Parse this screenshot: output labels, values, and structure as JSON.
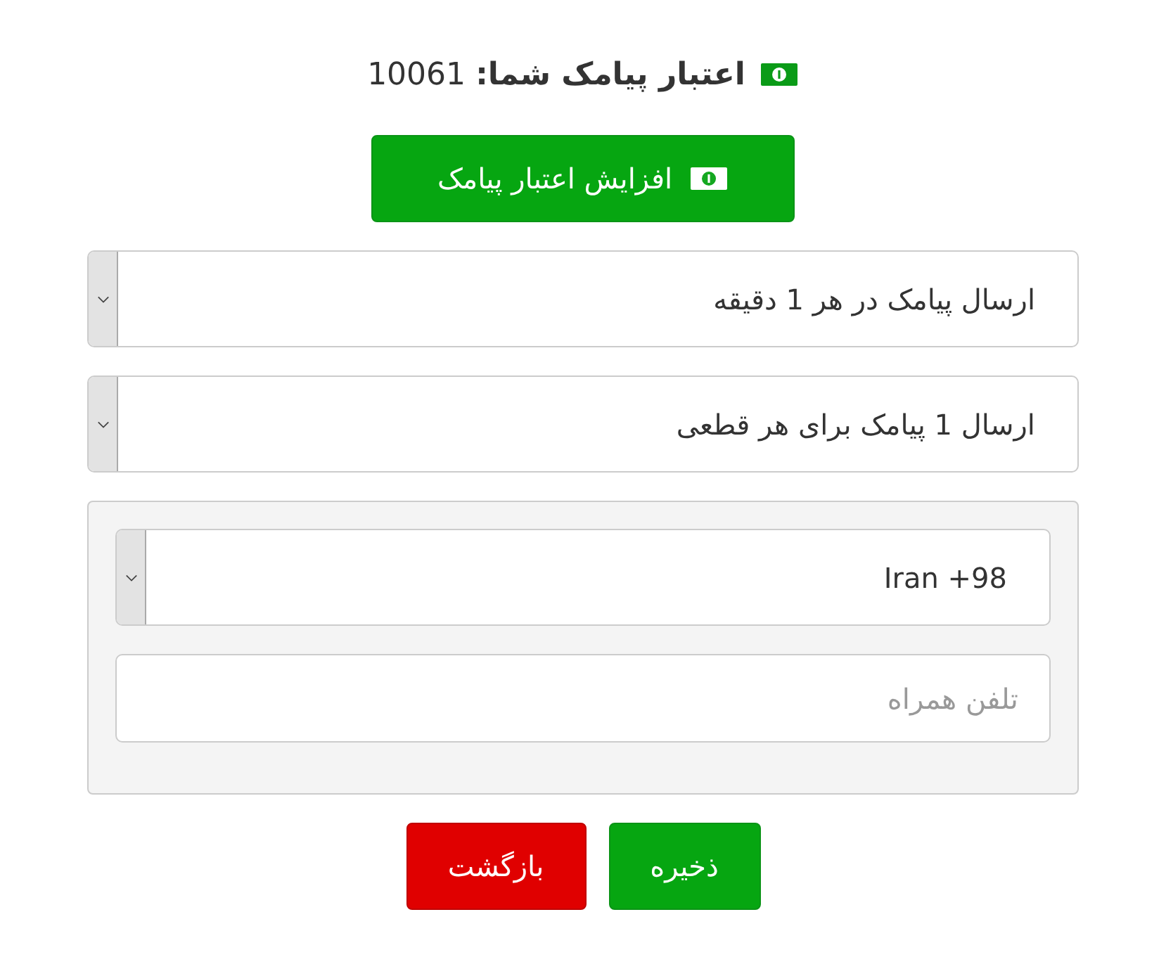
{
  "credit": {
    "text": "**اعتبار پیامک شما:** 10061"
  },
  "increase_button": {
    "label": "افزایش اعتبار پیامک"
  },
  "selects": [
    {
      "value": "ارسال پیامک در هر 1 دقیقه"
    },
    {
      "value": "ارسال 1 پیامک برای هر قطعی"
    }
  ],
  "phone_panel": {
    "country": {
      "value": "Iran +98"
    },
    "phone": {
      "placeholder": "تلفن همراه"
    }
  },
  "buttons": [
    {
      "label": "ذخیره",
      "kind": "primary"
    },
    {
      "label": "بازگشت",
      "kind": "danger"
    }
  ]
}
